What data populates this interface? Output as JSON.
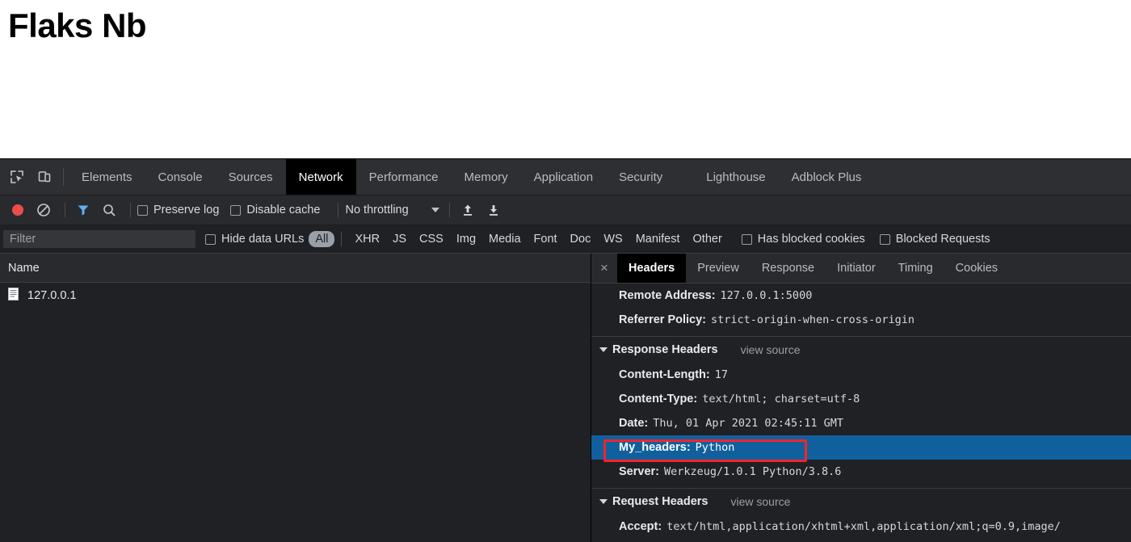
{
  "page": {
    "title": "Flaks Nb"
  },
  "devtools": {
    "tool_icons": [
      {
        "name": "inspect-element-icon"
      },
      {
        "name": "device-toolbar-icon"
      }
    ],
    "tabs": [
      {
        "label": "Elements",
        "selected": false
      },
      {
        "label": "Console",
        "selected": false
      },
      {
        "label": "Sources",
        "selected": false
      },
      {
        "label": "Network",
        "selected": true
      },
      {
        "label": "Performance",
        "selected": false
      },
      {
        "label": "Memory",
        "selected": false
      },
      {
        "label": "Application",
        "selected": false
      },
      {
        "label": "Security",
        "selected": false
      },
      {
        "label": "Lighthouse",
        "selected": false
      },
      {
        "label": "Adblock Plus",
        "selected": false
      }
    ]
  },
  "network_toolbar": {
    "record_button": "record-button",
    "clear_button": "clear-button",
    "filter_button": "filter-button",
    "search_button": "search-button",
    "preserve_log_label": "Preserve log",
    "preserve_log_checked": false,
    "disable_cache_label": "Disable cache",
    "disable_cache_checked": false,
    "throttling_value": "No throttling",
    "import_har_button": "import-har-button",
    "export_har_button": "export-har-button",
    "record_color": "#ed4c4c",
    "filter_active_color": "#5db0f7"
  },
  "filter_row": {
    "filter_placeholder": "Filter",
    "filter_value": "",
    "hide_data_urls_label": "Hide data URLs",
    "hide_data_urls_checked": false,
    "types": [
      {
        "label": "All",
        "selected": true
      },
      {
        "label": "XHR",
        "selected": false
      },
      {
        "label": "JS",
        "selected": false
      },
      {
        "label": "CSS",
        "selected": false
      },
      {
        "label": "Img",
        "selected": false
      },
      {
        "label": "Media",
        "selected": false
      },
      {
        "label": "Font",
        "selected": false
      },
      {
        "label": "Doc",
        "selected": false
      },
      {
        "label": "WS",
        "selected": false
      },
      {
        "label": "Manifest",
        "selected": false
      },
      {
        "label": "Other",
        "selected": false
      }
    ],
    "has_blocked_cookies_label": "Has blocked cookies",
    "has_blocked_cookies_checked": false,
    "blocked_requests_label": "Blocked Requests",
    "blocked_requests_checked": false
  },
  "request_list": {
    "column_header": "Name",
    "rows": [
      {
        "name": "127.0.0.1",
        "icon": "document-icon"
      }
    ]
  },
  "detail_panel": {
    "close_icon": "×",
    "tabs": [
      {
        "label": "Headers",
        "selected": true
      },
      {
        "label": "Preview",
        "selected": false
      },
      {
        "label": "Response",
        "selected": false
      },
      {
        "label": "Initiator",
        "selected": false
      },
      {
        "label": "Timing",
        "selected": false
      },
      {
        "label": "Cookies",
        "selected": false
      }
    ],
    "general_headers": [
      {
        "name": "Remote Address:",
        "value": "127.0.0.1:5000"
      },
      {
        "name": "Referrer Policy:",
        "value": "strict-origin-when-cross-origin"
      }
    ],
    "response_section": {
      "title": "Response Headers",
      "view_source": "view source",
      "headers": [
        {
          "name": "Content-Length:",
          "value": "17",
          "highlighted": false
        },
        {
          "name": "Content-Type:",
          "value": "text/html; charset=utf-8",
          "highlighted": false
        },
        {
          "name": "Date:",
          "value": "Thu, 01 Apr 2021 02:45:11 GMT",
          "highlighted": false
        },
        {
          "name": "My_headers:",
          "value": "Python",
          "highlighted": true
        },
        {
          "name": "Server:",
          "value": "Werkzeug/1.0.1 Python/3.8.6",
          "highlighted": false
        }
      ]
    },
    "request_section": {
      "title": "Request Headers",
      "view_source": "view source",
      "headers": [
        {
          "name": "Accept:",
          "value": "text/html,application/xhtml+xml,application/xml;q=0.9,image/",
          "highlighted": false
        }
      ]
    },
    "selection_color": "#11609e",
    "annotation_color": "#f5242a"
  }
}
